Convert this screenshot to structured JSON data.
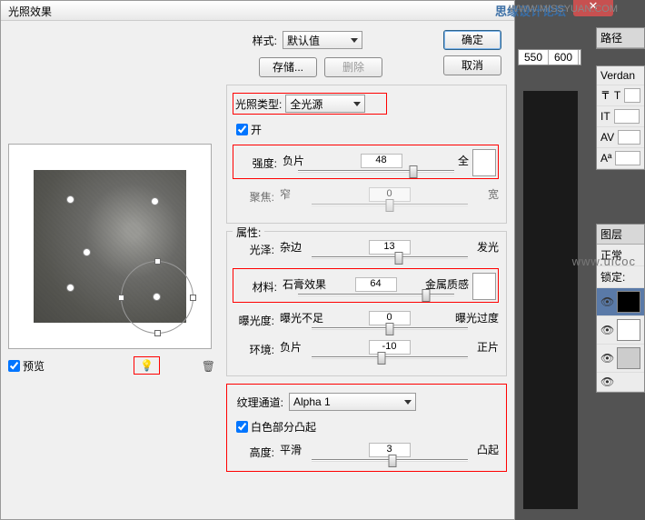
{
  "watermarks": {
    "site": "WWW.MISSYUAN.COM",
    "forum": "思缘设计论坛",
    "mid": "www.uicoc"
  },
  "dialog": {
    "title": "光照效果",
    "style_label": "样式:",
    "style_value": "默认值",
    "save": "存储...",
    "delete": "删除",
    "ok": "确定",
    "cancel": "取消",
    "light_type_label": "光照类型:",
    "light_type_value": "全光源",
    "on": "开",
    "preview": "预览",
    "intensity": {
      "label": "强度:",
      "left": "负片",
      "right": "全",
      "value": "48"
    },
    "focus": {
      "label": "聚焦:",
      "left": "窄",
      "right": "宽",
      "value": "0"
    },
    "props_legend": "属性:",
    "gloss": {
      "label": "光泽:",
      "left": "杂边",
      "right": "发光",
      "value": "13"
    },
    "material": {
      "label": "材料:",
      "left": "石膏效果",
      "right": "金属质感",
      "value": "64"
    },
    "exposure": {
      "label": "曝光度:",
      "left": "曝光不足",
      "right": "曝光过度",
      "value": "0"
    },
    "ambience": {
      "label": "环境:",
      "left": "负片",
      "right": "正片",
      "value": "-10"
    },
    "texture_label": "纹理通道:",
    "texture_value": "Alpha 1",
    "white_high": "白色部分凸起",
    "height": {
      "label": "高度:",
      "left": "平滑",
      "right": "凸起",
      "value": "3"
    }
  },
  "ps": {
    "paths_tab": "路径",
    "font": "Verdan",
    "ruler": [
      "550",
      "600"
    ],
    "layers_tab": "图层",
    "blend": "正常",
    "lock": "锁定:",
    "char_T": "T",
    "char_IT": "IT",
    "char_AV": "AV",
    "char_Aa": "Aª"
  }
}
